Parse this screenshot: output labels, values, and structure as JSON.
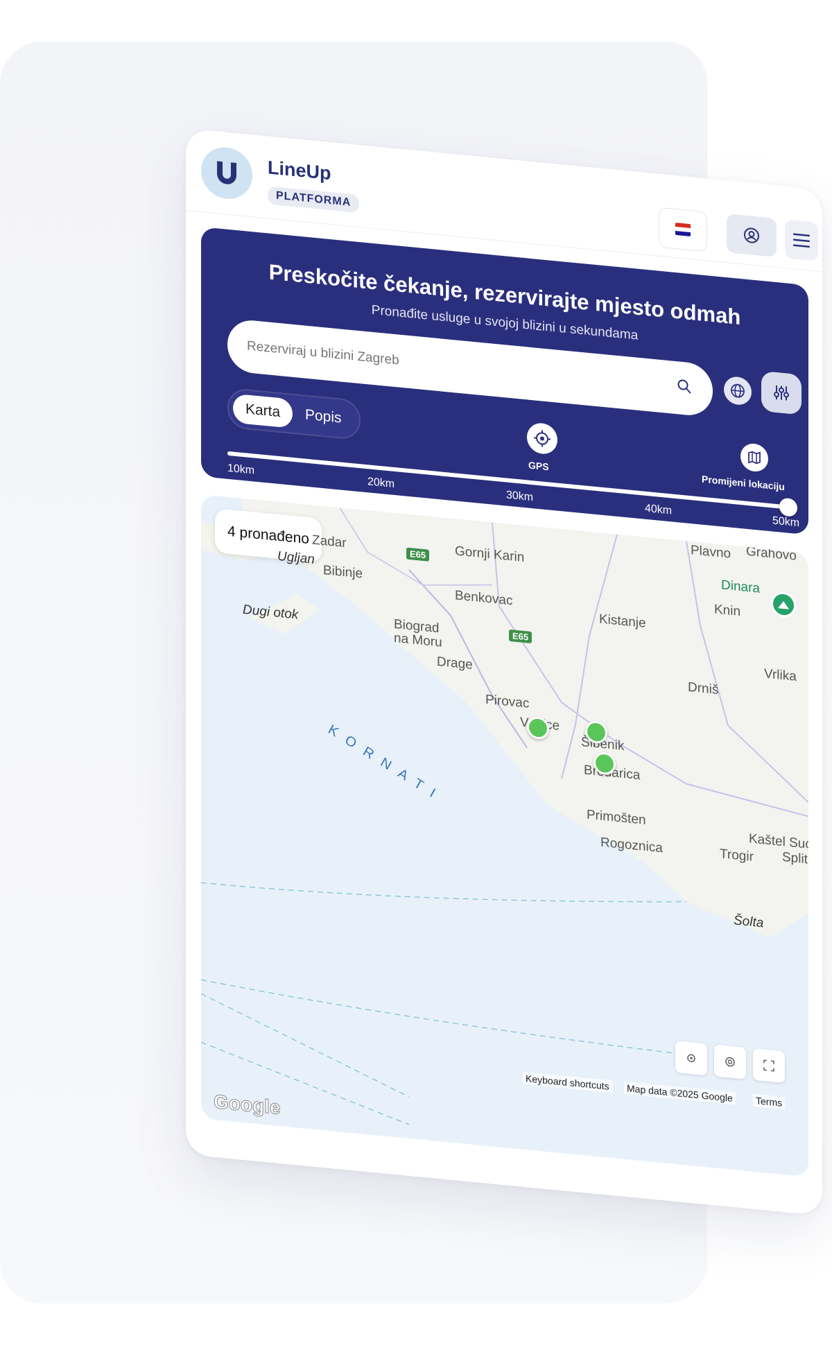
{
  "header": {
    "brand_name": "LineUp",
    "brand_tag": "PLATFORMA",
    "logo_icon": "lineup-u-logo",
    "language_flag": "croatia-flag",
    "profile_icon": "user-circle-icon",
    "menu_icon": "hamburger-menu-icon"
  },
  "hero": {
    "title": "Preskočite čekanje, rezervirajte mjesto odmah",
    "subtitle": "Pronađite usluge u svojoj blizini u sekundama",
    "search_placeholder": "Rezerviraj u blizini Zagreb",
    "view_toggle": {
      "selected": "Karta",
      "options": [
        "Karta",
        "Popis"
      ]
    },
    "gps_label": "GPS",
    "change_location_label": "Promijeni lokaciju",
    "radius": {
      "ticks": [
        "10km",
        "20km",
        "30km",
        "40km",
        "50km"
      ],
      "selected": "50km"
    },
    "colors": {
      "primary": "#2a2f7d",
      "logo_bg": "#cfe3f2"
    }
  },
  "map": {
    "found_label": "4 pronađeno",
    "places": {
      "zadar": "Zadar",
      "ugljan": "Ugljan",
      "bibinje": "Bibinje",
      "dugi_otok": "Dugi otok",
      "gornji_karin": "Gornji Karin",
      "benkovac": "Benkovac",
      "biograd": "Biograd",
      "na_moru": "na Moru",
      "drage": "Drage",
      "pirovac": "Pirovac",
      "kistanje": "Kistanje",
      "plavno": "Plavno",
      "grahovo": "Grahovo",
      "dinara": "Dinara",
      "knin": "Knin",
      "vrlika": "Vrlika",
      "drnis": "Drniš",
      "vodice": "Vodice",
      "sibenik": "Šibenik",
      "brodarica": "Brodarica",
      "primosten": "Primošten",
      "rogoznica": "Rogoznica",
      "trogir": "Trogir",
      "kastel": "Kaštel Suć",
      "split": "Split",
      "solta": "Šolta"
    },
    "kornati": "KORNATI",
    "roads": [
      "E65",
      "E65"
    ],
    "attribution": {
      "shortcuts": "Keyboard shortcuts",
      "data": "Map data ©2025 Google",
      "terms": "Terms"
    },
    "google_logo": "Google",
    "pin_color": "#5ac65a"
  }
}
